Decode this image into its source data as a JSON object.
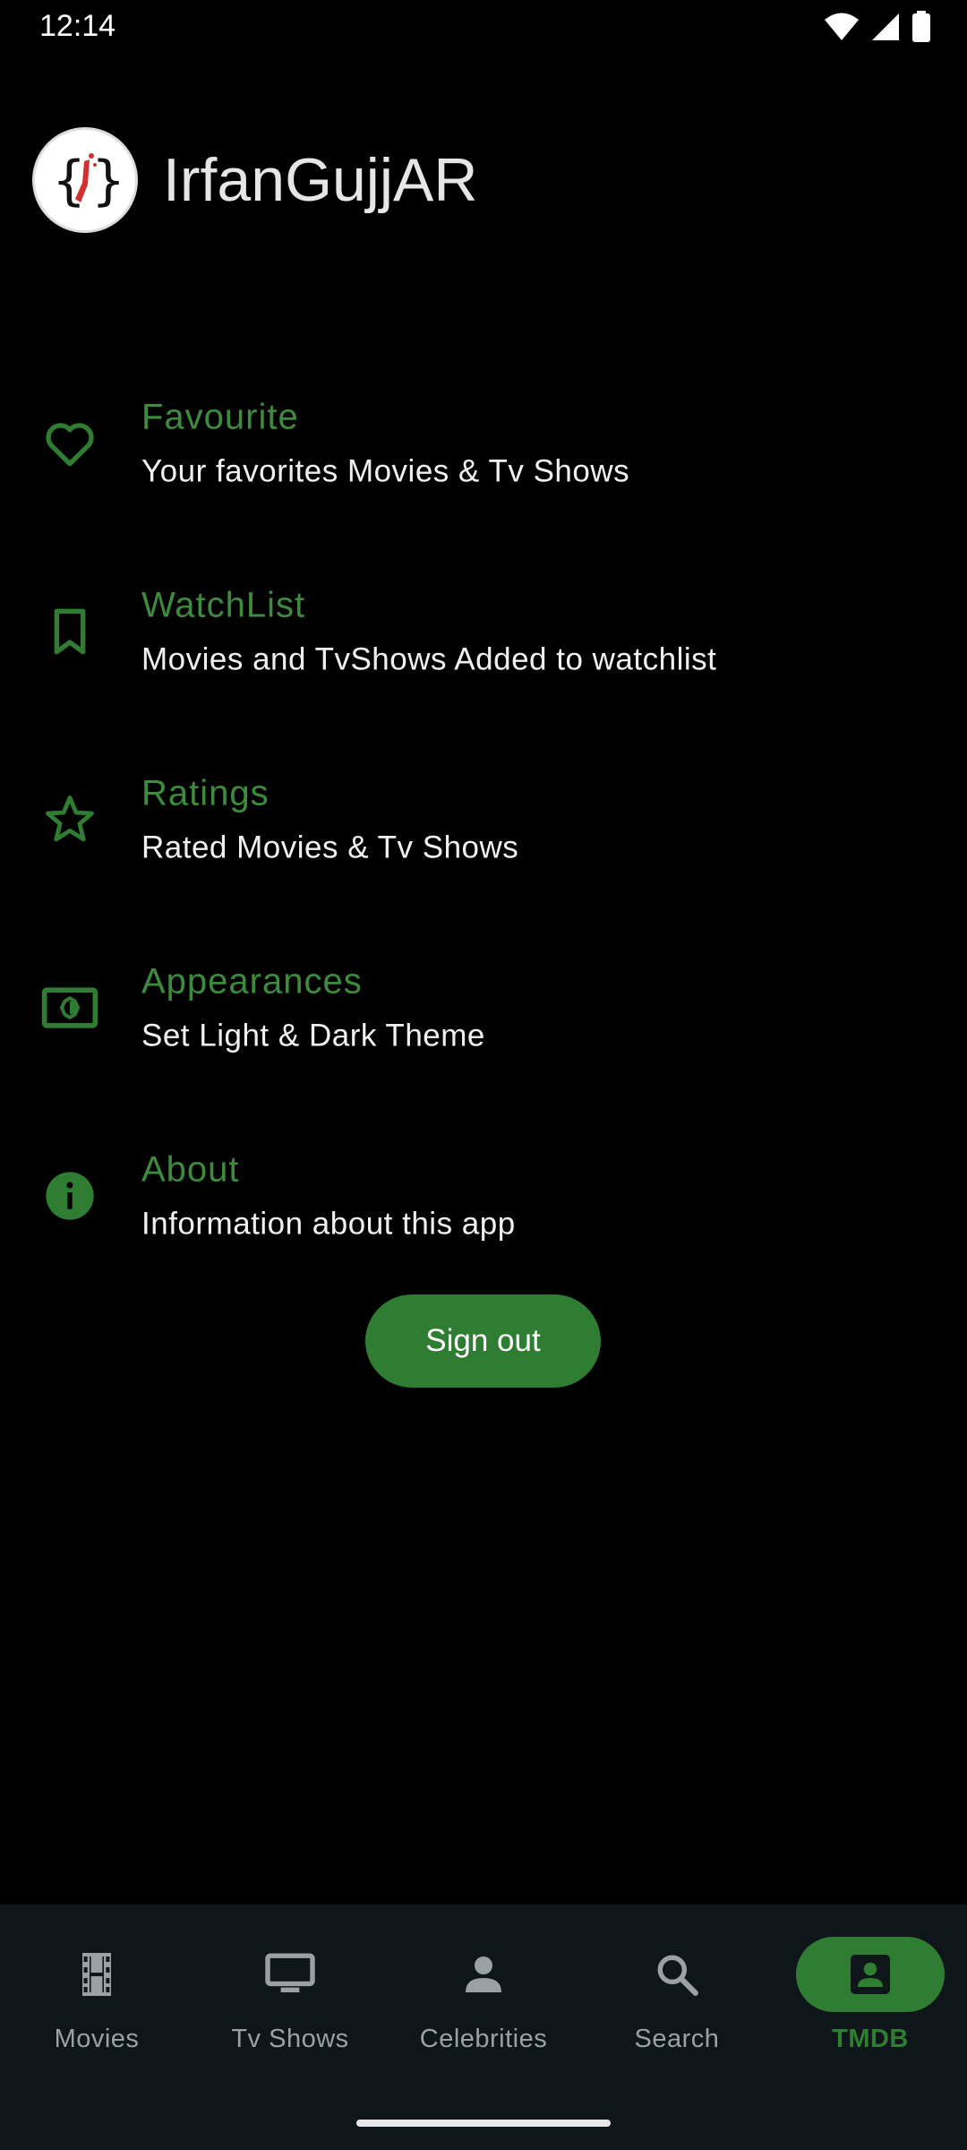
{
  "status_bar": {
    "time": "12:14",
    "icons": [
      "wifi-icon",
      "signal-icon",
      "battery-icon"
    ]
  },
  "header": {
    "username": "IrfanGujjAR",
    "avatar_icon": "code-braces-logo"
  },
  "colors": {
    "accent": "#2e7d32",
    "accent_text": "#3d8b3d",
    "background": "#000000",
    "nav_background": "#0f1619"
  },
  "menu": [
    {
      "title": "Favourite",
      "subtitle": "Your favorites Movies & Tv Shows",
      "icon": "heart-outline-icon"
    },
    {
      "title": "WatchList",
      "subtitle": "Movies and TvShows Added to watchlist",
      "icon": "bookmark-outline-icon"
    },
    {
      "title": "Ratings",
      "subtitle": "Rated Movies & Tv Shows",
      "icon": "star-outline-icon"
    },
    {
      "title": "Appearances",
      "subtitle": "Set Light & Dark Theme",
      "icon": "brightness-icon"
    },
    {
      "title": "About",
      "subtitle": "Information about this app",
      "icon": "info-icon"
    }
  ],
  "signout_label": "Sign out",
  "nav": [
    {
      "label": "Movies",
      "icon": "film-icon",
      "active": false
    },
    {
      "label": "Tv Shows",
      "icon": "tv-icon",
      "active": false
    },
    {
      "label": "Celebrities",
      "icon": "person-icon",
      "active": false
    },
    {
      "label": "Search",
      "icon": "search-icon",
      "active": false
    },
    {
      "label": "TMDB",
      "icon": "account-box-icon",
      "active": true
    }
  ]
}
